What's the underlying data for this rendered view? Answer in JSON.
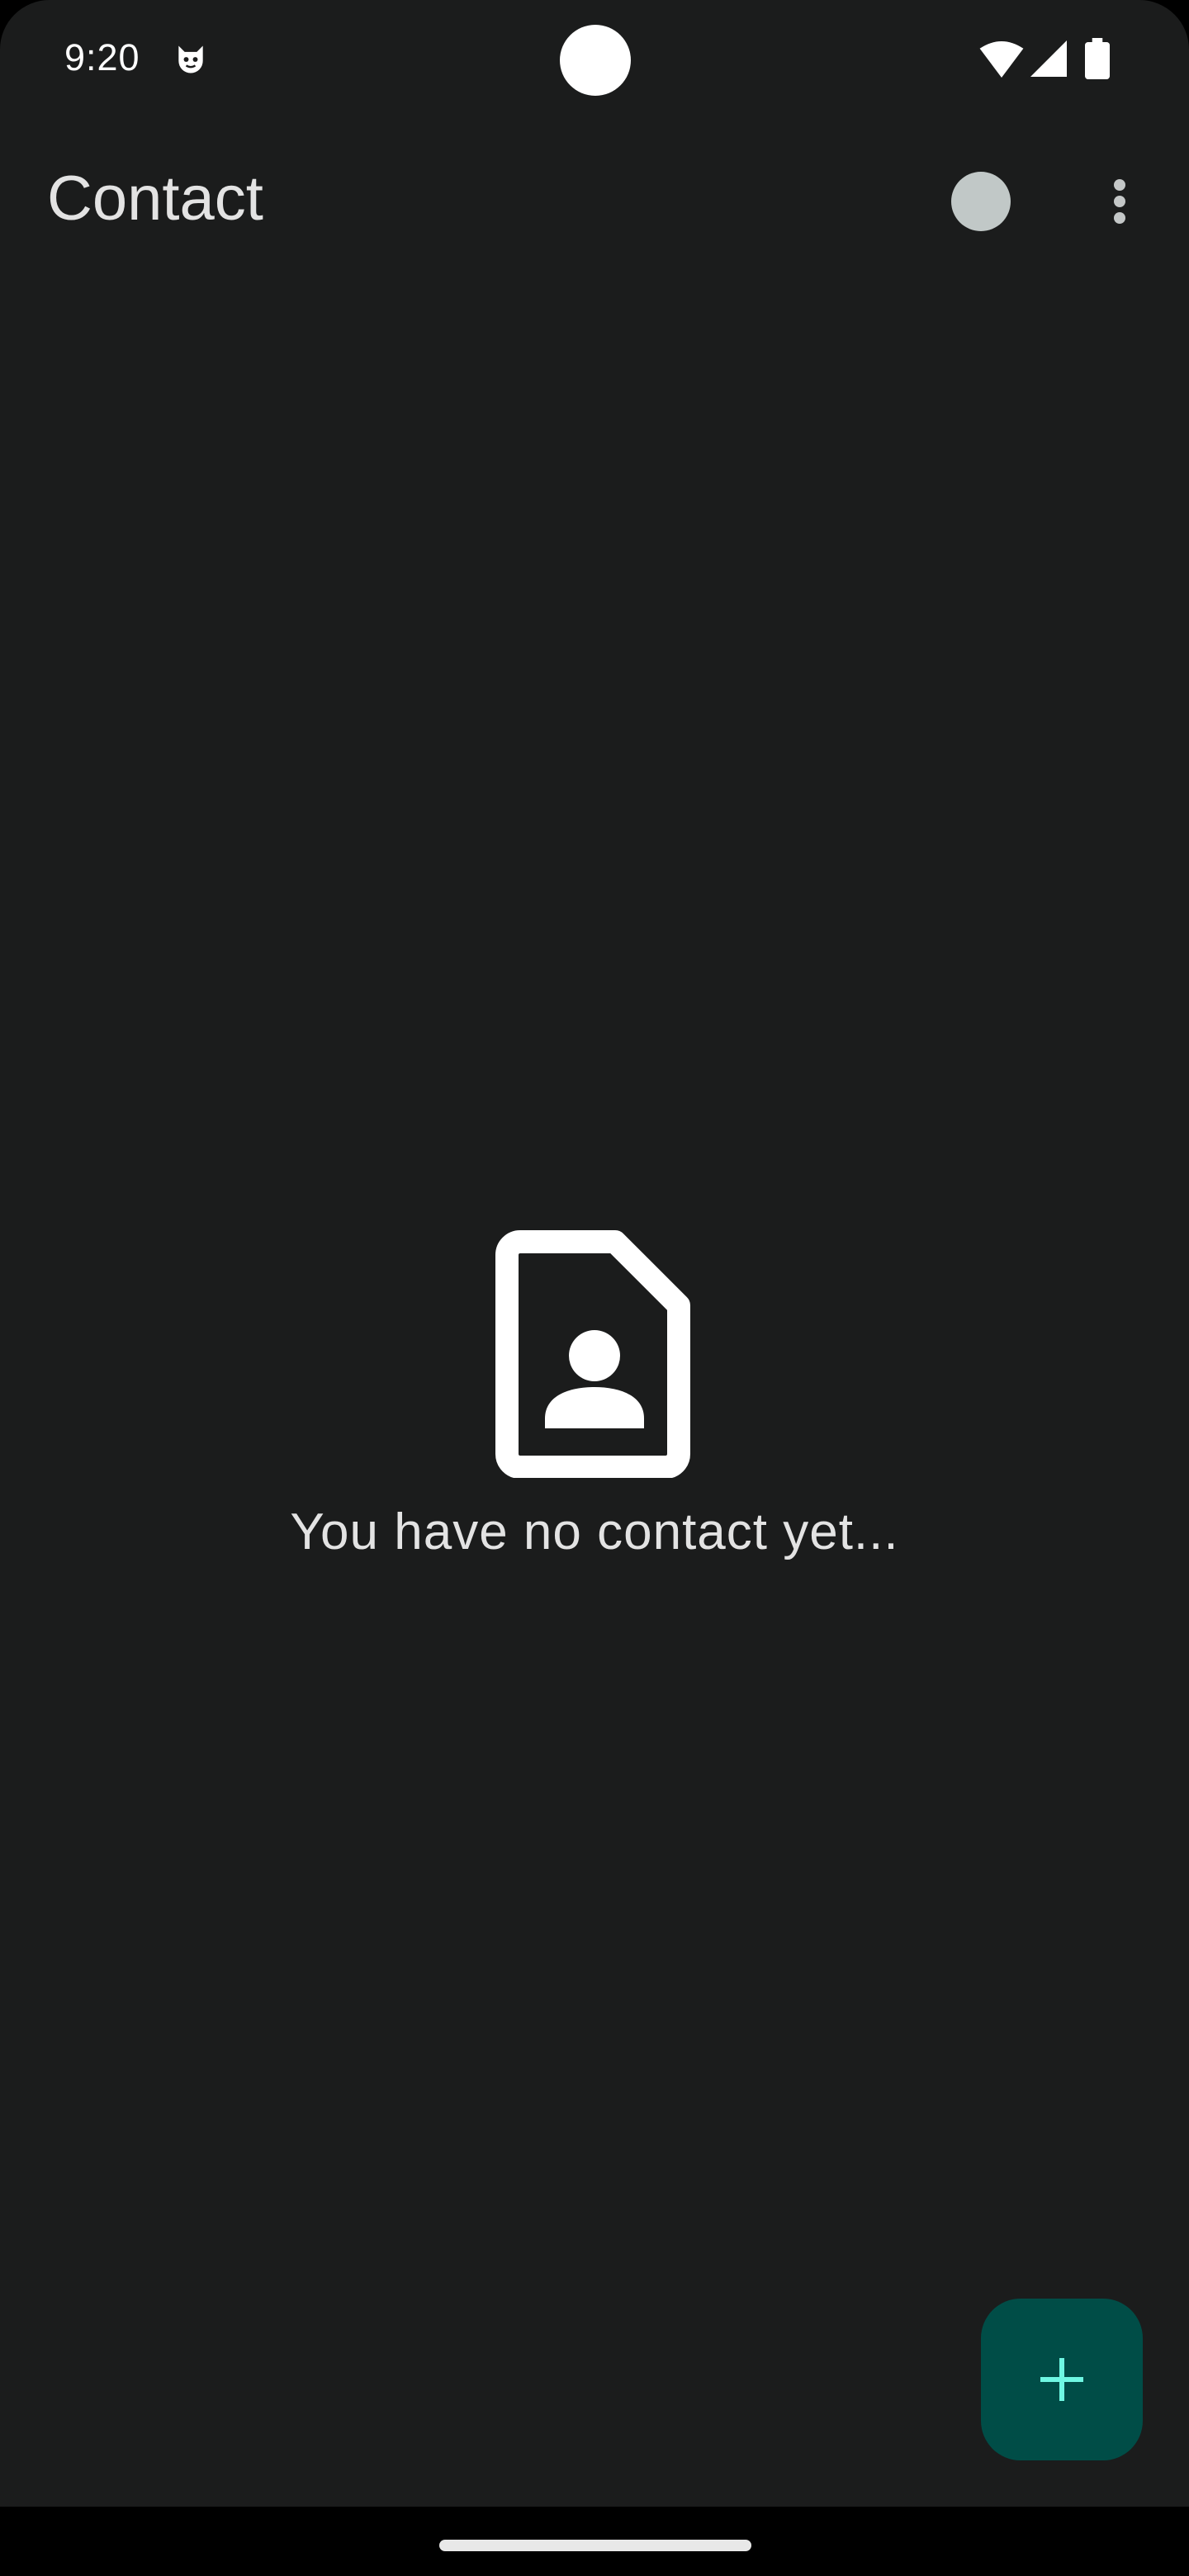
{
  "status_bar": {
    "time": "9:20",
    "notification_icon": "cat-face-icon",
    "wifi_icon": "wifi-icon",
    "signal_icon": "cellular-signal-icon",
    "battery_icon": "battery-icon"
  },
  "app_bar": {
    "title": "Contact",
    "avatar_color": "#c1c8c7",
    "more_icon": "more-vert-icon"
  },
  "empty_state": {
    "icon": "contact-card-icon",
    "message": "You have no contact yet..."
  },
  "fab": {
    "icon": "plus-icon",
    "background": "#004d47",
    "icon_color": "#6ff7e3"
  },
  "colors": {
    "background": "#1b1c1c",
    "text": "#e3e3e3"
  }
}
